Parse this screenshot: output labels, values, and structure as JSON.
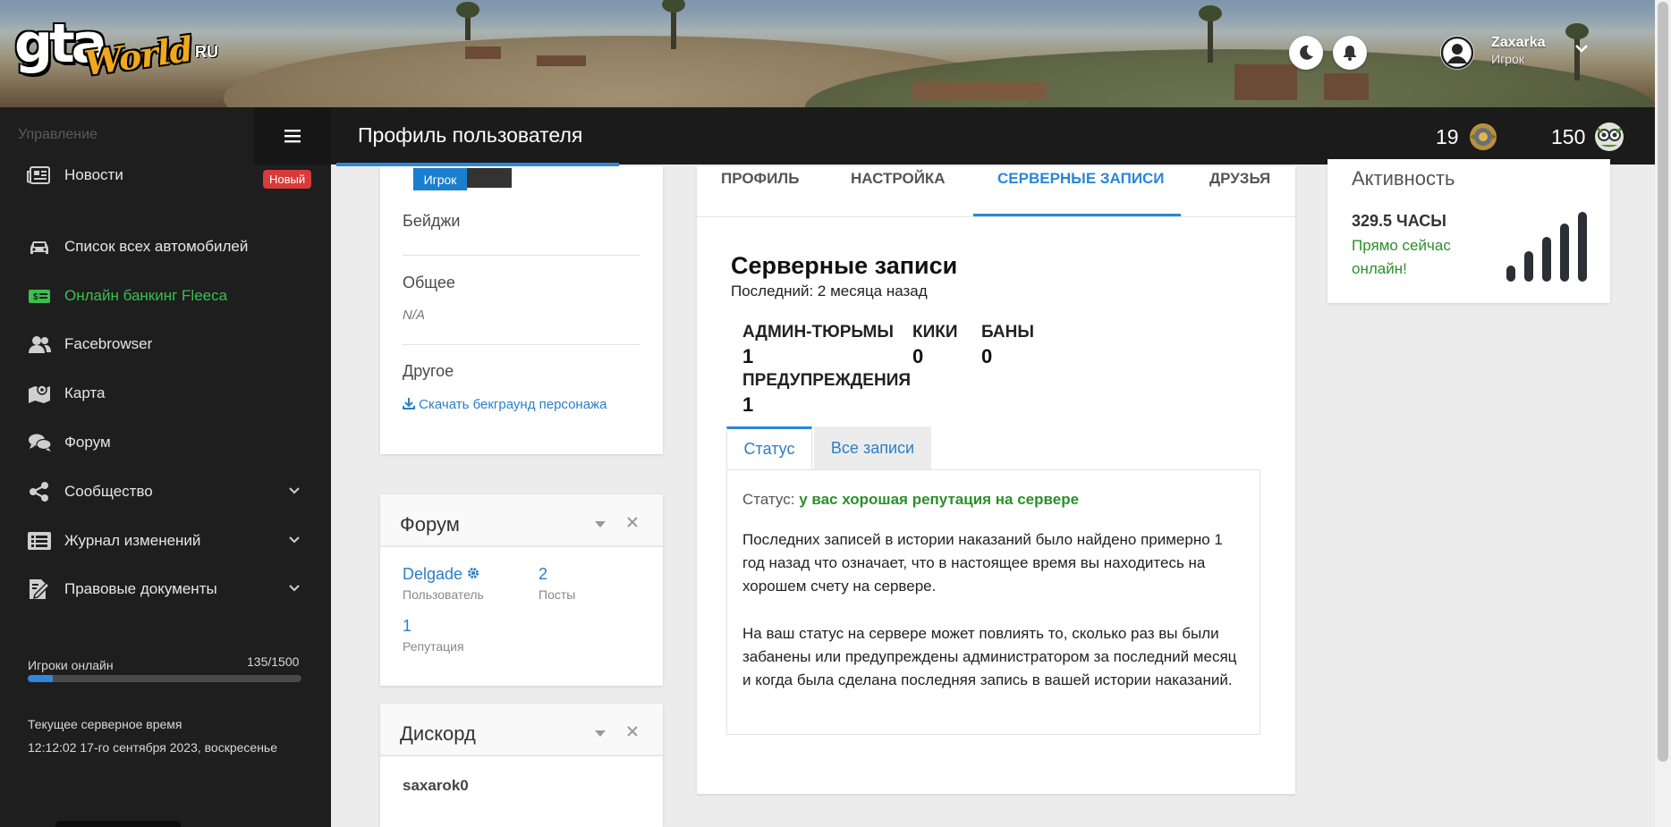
{
  "brand": {
    "logo_main": "gta",
    "logo_world": "World",
    "logo_tld": "RU"
  },
  "header": {
    "user_name": "Zaxarka",
    "user_role": "Игрок",
    "page_title": "Профиль пользователя",
    "stat_left": "19",
    "stat_right": "150"
  },
  "sidebar": {
    "section_label": "Управление",
    "badge_new": "Новый",
    "items": [
      {
        "label": "Новости",
        "icon": "news-icon"
      },
      {
        "label": "Список всех автомобилей",
        "icon": "car-icon"
      },
      {
        "label": "Онлайн банкинг Fleeca",
        "icon": "money-icon"
      },
      {
        "label": "Facebrowser",
        "icon": "users-icon"
      },
      {
        "label": "Карта",
        "icon": "map-icon"
      },
      {
        "label": "Форум",
        "icon": "chat-icon"
      },
      {
        "label": "Сообщество",
        "icon": "share-icon"
      },
      {
        "label": "Журнал изменений",
        "icon": "list-icon"
      },
      {
        "label": "Правовые документы",
        "icon": "document-icon"
      }
    ],
    "online_label": "Игроки онлайн",
    "online_count": "135/1500",
    "online_fraction": 0.09,
    "time_label": "Текущее серверное время",
    "time_value": "12:12:02 17-го сентября 2023, воскресенье"
  },
  "profile": {
    "role_tag": "Игрок",
    "badges_heading": "Бейджи",
    "general_heading": "Общее",
    "general_value": "N/A",
    "other_heading": "Другое",
    "download_link": "Скачать бекграунд персонажа"
  },
  "forum": {
    "title": "Форум",
    "user_value": "Delgade",
    "user_label": "Пользователь",
    "posts_value": "2",
    "posts_label": "Посты",
    "rep_value": "1",
    "rep_label": "Репутация"
  },
  "discord": {
    "title": "Дискорд",
    "username": "saxarok0"
  },
  "tabs": [
    "ПРОФИЛЬ",
    "НАСТРОЙКА",
    "СЕРВЕРНЫЕ ЗАПИСИ",
    "ДРУЗЬЯ"
  ],
  "server_records": {
    "title": "Серверные записи",
    "last": "Последний: 2 месяца назад",
    "jail_label": "АДМИН-ТЮРЬМЫ",
    "jail_value": "1",
    "kicks_label": "КИКИ",
    "kicks_value": "0",
    "bans_label": "БАНЫ",
    "bans_value": "0",
    "warnings_label": "ПРЕДУПРЕЖДЕНИЯ",
    "warnings_value": "1",
    "subtabs": [
      "Статус",
      "Все записи"
    ],
    "status_prefix": "Статус:",
    "status_value": "у вас хорошая репутация на сервере",
    "paragraph1": "Последних записей в истории наказаний было найдено примерно 1 год назад что означает, что в настоящее время вы находитесь на хорошем счету на сервере.",
    "paragraph2": "На ваш статус на сервере может повлиять то, сколько раз вы были забанены или предупреждены администратором за последний месяц и когда была сделана последняя запись в вашей истории наказаний."
  },
  "activity": {
    "title": "Активность",
    "hours": "329.5 ЧАСЫ",
    "online_text": "Прямо сейчас онлайн!"
  }
}
